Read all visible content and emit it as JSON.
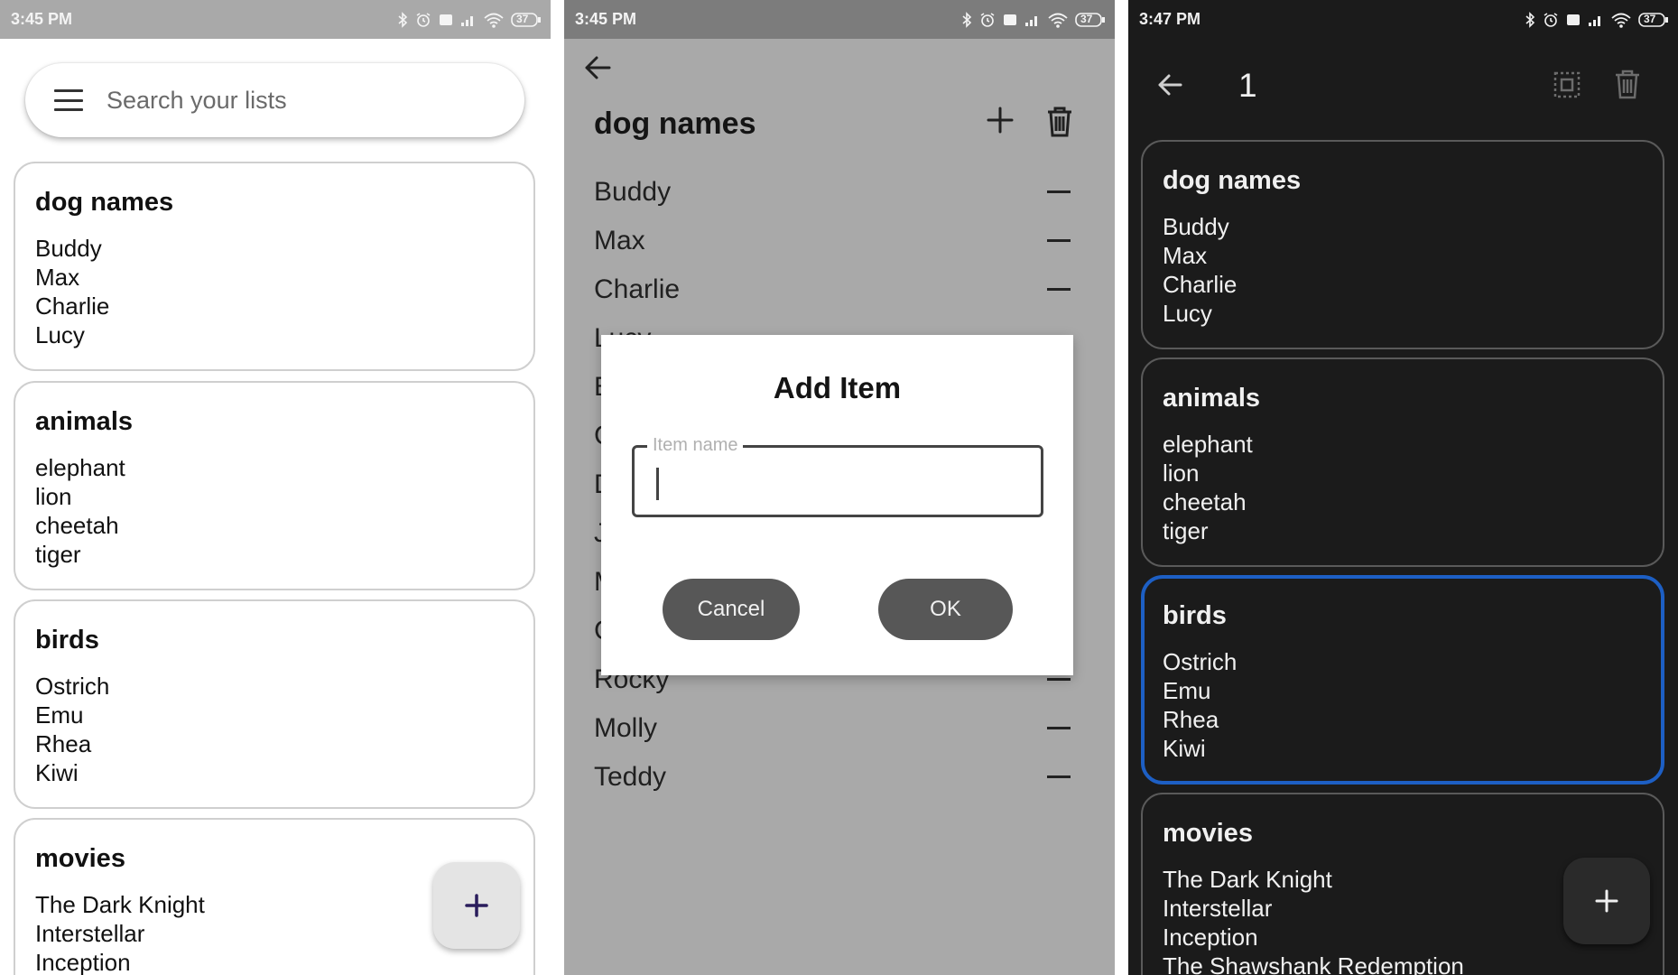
{
  "screen_home": {
    "status": {
      "time": "3:45 PM",
      "battery": "37"
    },
    "search_placeholder": "Search your lists",
    "lists": [
      {
        "title": "dog names",
        "items": [
          "Buddy",
          "Max",
          "Charlie",
          "Lucy"
        ]
      },
      {
        "title": "animals",
        "items": [
          "elephant",
          "lion",
          "cheetah",
          "tiger"
        ]
      },
      {
        "title": "birds",
        "items": [
          "Ostrich",
          "Emu",
          "Rhea",
          "Kiwi"
        ]
      },
      {
        "title": "movies",
        "items": [
          "The Dark Knight",
          "Interstellar",
          "Inception"
        ]
      }
    ],
    "fab_icon": "plus-icon"
  },
  "screen_list": {
    "status": {
      "time": "3:45 PM",
      "battery": "37"
    },
    "title": "dog names",
    "items_top": [
      "Buddy",
      "Max",
      "Charlie"
    ],
    "items_partial": [
      "Lucy",
      "B",
      "C",
      "D",
      "J",
      "M",
      "C"
    ],
    "items_bottom": [
      "Rocky",
      "Molly",
      "Teddy"
    ],
    "dialog": {
      "title": "Add Item",
      "field_label": "Item name",
      "field_value": "",
      "cancel": "Cancel",
      "ok": "OK"
    }
  },
  "screen_selection": {
    "status": {
      "time": "3:47 PM",
      "battery": "37"
    },
    "selected_count": "1",
    "lists": [
      {
        "title": "dog names",
        "items": [
          "Buddy",
          "Max",
          "Charlie",
          "Lucy"
        ]
      },
      {
        "title": "animals",
        "items": [
          "elephant",
          "lion",
          "cheetah",
          "tiger"
        ]
      },
      {
        "title": "birds",
        "items": [
          "Ostrich",
          "Emu",
          "Rhea",
          "Kiwi"
        ],
        "selected": true
      },
      {
        "title": "movies",
        "items": [
          "The Dark Knight",
          "Interstellar",
          "Inception",
          "The Shawshank Redemption"
        ]
      }
    ],
    "fab_icon": "plus-icon"
  },
  "colors": {
    "selection_border": "#1d5fc4",
    "dialog_button": "#575757",
    "scrim": "#a9a9a9",
    "dark_bg": "#1b1b1b"
  }
}
